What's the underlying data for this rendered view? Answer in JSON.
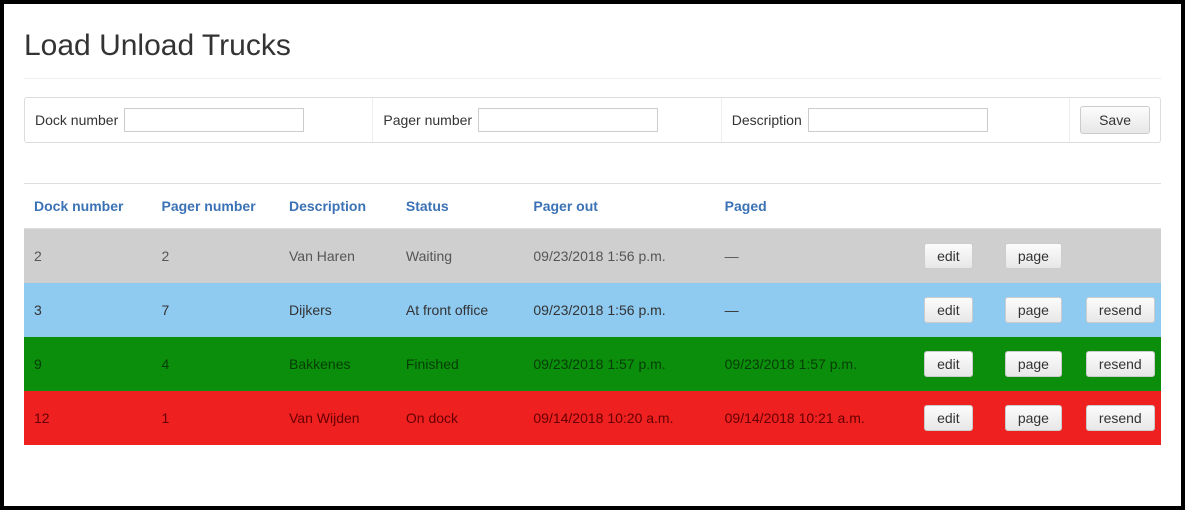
{
  "page": {
    "title": "Load Unload Trucks"
  },
  "form": {
    "dock_label": "Dock number",
    "dock_value": "",
    "pager_label": "Pager number",
    "pager_value": "",
    "description_label": "Description",
    "description_value": "",
    "save_label": "Save"
  },
  "table": {
    "headers": {
      "dock": "Dock number",
      "pager": "Pager number",
      "description": "Description",
      "status": "Status",
      "pager_out": "Pager out",
      "paged": "Paged"
    },
    "rows": [
      {
        "dock": "2",
        "pager": "2",
        "description": "Van Haren",
        "status": "Waiting",
        "pager_out": "09/23/2018 1:56 p.m.",
        "paged": "—",
        "css": "status-waiting",
        "edit": "edit",
        "page": "page",
        "resend": ""
      },
      {
        "dock": "3",
        "pager": "7",
        "description": "Dijkers",
        "status": "At front office",
        "pager_out": "09/23/2018 1:56 p.m.",
        "paged": "—",
        "css": "status-frontoffice",
        "edit": "edit",
        "page": "page",
        "resend": "resend"
      },
      {
        "dock": "9",
        "pager": "4",
        "description": "Bakkenes",
        "status": "Finished",
        "pager_out": "09/23/2018 1:57 p.m.",
        "paged": "09/23/2018 1:57 p.m.",
        "css": "status-finished",
        "edit": "edit",
        "page": "page",
        "resend": "resend"
      },
      {
        "dock": "12",
        "pager": "1",
        "description": "Van Wijden",
        "status": "On dock",
        "pager_out": "09/14/2018 10:20 a.m.",
        "paged": "09/14/2018 10:21 a.m.",
        "css": "status-ondock",
        "edit": "edit",
        "page": "page",
        "resend": "resend"
      }
    ]
  }
}
